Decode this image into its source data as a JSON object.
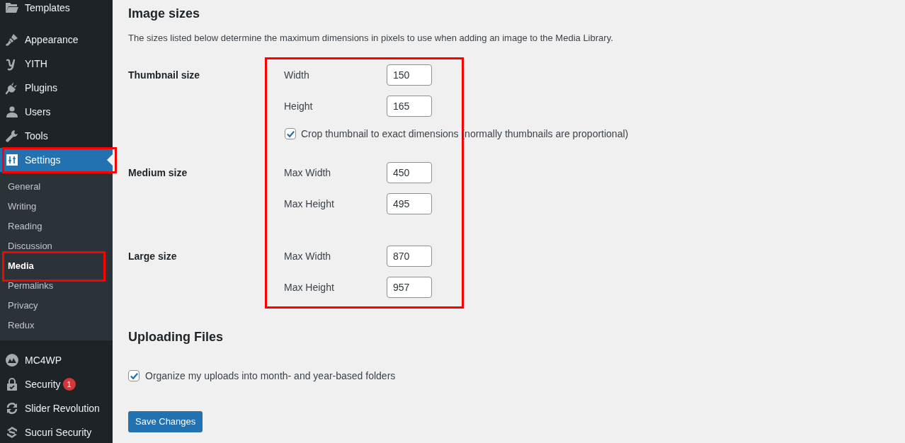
{
  "sidebar": {
    "groups": [
      {
        "items": [
          {
            "label": "Templates",
            "selected": false,
            "highlighted": false
          }
        ]
      },
      {
        "items": [
          {
            "label": "Appearance",
            "selected": false,
            "highlighted": false
          },
          {
            "label": "YITH",
            "selected": false,
            "highlighted": false
          },
          {
            "label": "Plugins",
            "selected": false,
            "highlighted": false
          },
          {
            "label": "Users",
            "selected": false,
            "highlighted": false
          },
          {
            "label": "Tools",
            "selected": false,
            "highlighted": false
          },
          {
            "label": "Settings",
            "selected": true,
            "highlighted": true,
            "submenu": [
              {
                "label": "General",
                "selected": false,
                "highlighted": false
              },
              {
                "label": "Writing",
                "selected": false,
                "highlighted": false
              },
              {
                "label": "Reading",
                "selected": false,
                "highlighted": false
              },
              {
                "label": "Discussion",
                "selected": false,
                "highlighted": false
              },
              {
                "label": "Media",
                "selected": true,
                "highlighted": true
              },
              {
                "label": "Permalinks",
                "selected": false,
                "highlighted": false
              },
              {
                "label": "Privacy",
                "selected": false,
                "highlighted": false
              },
              {
                "label": "Redux",
                "selected": false,
                "highlighted": false
              }
            ]
          }
        ]
      },
      {
        "items": [
          {
            "label": "MC4WP",
            "selected": false,
            "highlighted": false
          },
          {
            "label": "Security",
            "selected": false,
            "highlighted": false,
            "badge": "1"
          },
          {
            "label": "Slider Revolution",
            "selected": false,
            "highlighted": false
          },
          {
            "label": "Sucuri Security",
            "selected": false,
            "highlighted": false
          }
        ]
      }
    ]
  },
  "image_sizes": {
    "title": "Image sizes",
    "description": "The sizes listed below determine the maximum dimensions in pixels to use when adding an image to the Media Library.",
    "highlighted": true,
    "rows": [
      {
        "label": "Thumbnail size",
        "fields": [
          {
            "label": "Width",
            "value": "150"
          },
          {
            "label": "Height",
            "value": "165"
          }
        ],
        "option": {
          "label": "Crop thumbnail to exact dimensions (normally thumbnails are proportional)",
          "checked": true
        }
      },
      {
        "label": "Medium size",
        "fields": [
          {
            "label": "Max Width",
            "value": "450"
          },
          {
            "label": "Max Height",
            "value": "495"
          }
        ]
      },
      {
        "label": "Large size",
        "fields": [
          {
            "label": "Max Width",
            "value": "870"
          },
          {
            "label": "Max Height",
            "value": "957"
          }
        ]
      }
    ]
  },
  "uploading_files": {
    "title": "Uploading Files",
    "options": [
      {
        "label": "Organize my uploads into month- and year-based folders",
        "checked": true
      }
    ]
  },
  "save_button": {
    "label": "Save Changes"
  }
}
